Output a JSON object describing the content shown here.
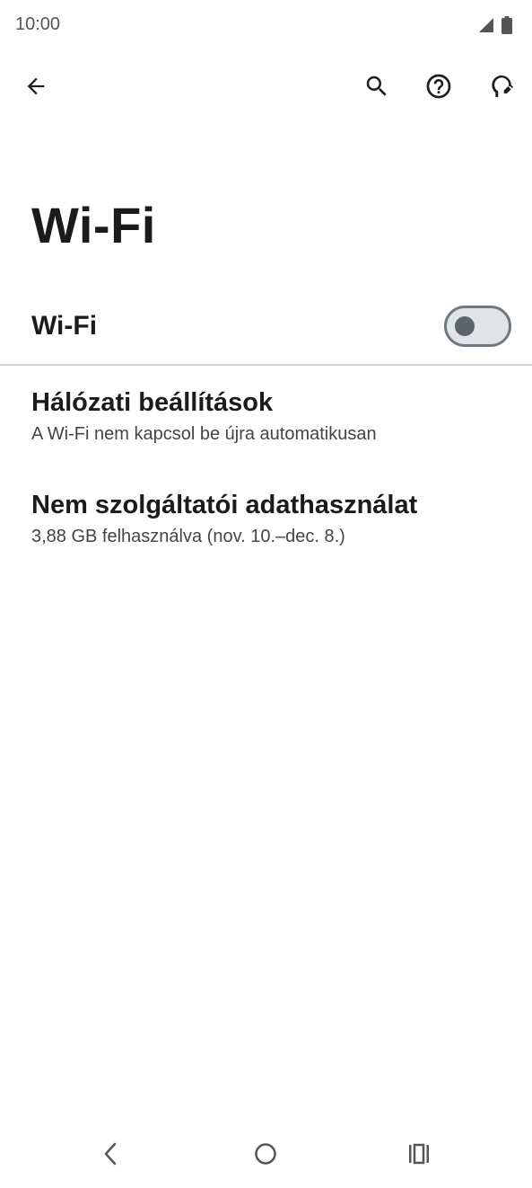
{
  "status_bar": {
    "time": "10:00",
    "icons": [
      "signal-icon",
      "battery-icon"
    ]
  },
  "toolbar": {
    "icons": [
      "back-arrow-icon",
      "search-icon",
      "help-icon",
      "feedback-icon"
    ]
  },
  "page": {
    "title": "Wi-Fi"
  },
  "wifi_toggle": {
    "label": "Wi-Fi",
    "state": "off"
  },
  "preferences": [
    {
      "title": "Hálózati beállítások",
      "summary": "A Wi-Fi nem kapcsol be újra automatikusan"
    },
    {
      "title": "Nem szolgáltatói adathasználat",
      "summary": "3,88 GB felhasználva (nov. 10.–dec. 8.)"
    }
  ],
  "nav_bar": {
    "icons": [
      "nav-back-icon",
      "nav-home-icon",
      "nav-recents-icon"
    ]
  },
  "colors": {
    "background": "#ffffff",
    "text_primary": "#1b1b1b",
    "text_secondary": "#444444",
    "toggle_track": "#e0e4e7",
    "toggle_border": "#6f7a80",
    "toggle_thumb": "#5e6469",
    "divider": "#cfd3d6"
  }
}
